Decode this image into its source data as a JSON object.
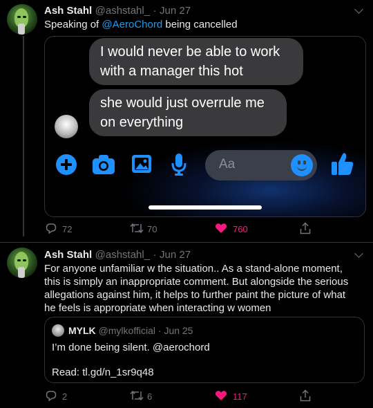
{
  "tweet1": {
    "name": "Ash Stahl",
    "handle": "@ashstahl_",
    "dot": "·",
    "date": "Jun 27",
    "text_before": "Speaking of ",
    "mention": "@AeroChord",
    "text_after": " being cancelled",
    "media": {
      "message1": "I would never be able to work with a manager this hot",
      "message2": "she would just overrule me on everything",
      "input_placeholder": "Aa"
    },
    "actions": {
      "replies": "72",
      "retweets": "70",
      "likes": "760"
    }
  },
  "tweet2": {
    "name": "Ash Stahl",
    "handle": "@ashstahl_",
    "dot": "·",
    "date": "Jun 27",
    "text": "For anyone unfamiliar w the situation.. As a stand-alone moment, this is simply an inappropriate comment. But alongside the serious allegations against him, it helps to further paint the picture of what he feels is appropriate when interacting w women",
    "quote": {
      "name": "MYLK",
      "handle": "@mylkofficial",
      "dot": "·",
      "date": "Jun 25",
      "line1": "I’m done being silent. @aerochord",
      "line2": "Read: tl.gd/n_1sr9q48"
    },
    "actions": {
      "replies": "2",
      "retweets": "6",
      "likes": "117"
    }
  },
  "colors": {
    "like": "#f91880",
    "link": "#1d9bf0",
    "messenger_blue": "#1e90ff",
    "bubble": "#3a3a3c"
  },
  "icons": [
    "reply-icon",
    "retweet-icon",
    "heart-icon",
    "share-icon",
    "plus-icon",
    "camera-icon",
    "image-icon",
    "mic-icon",
    "emoji-icon",
    "thumbs-up-icon",
    "chevron-down-icon"
  ]
}
